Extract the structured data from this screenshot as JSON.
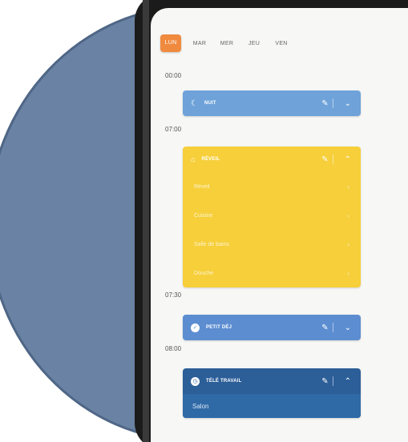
{
  "days": [
    "LUN",
    "MAR",
    "MER",
    "JEU",
    "VEN"
  ],
  "active_day_index": 0,
  "times": [
    "00:00",
    "07:00",
    "07:30",
    "08:00"
  ],
  "cards": {
    "nuit": {
      "title": "NUIT",
      "color": "#6ea2d9",
      "icon": "moon-icon"
    },
    "matin": {
      "title": "RÉVEIL",
      "color": "#f6cf3a",
      "icon": "bed-icon",
      "rows": [
        "Réveil",
        "Cuisine",
        "Salle de bains",
        "Douche"
      ]
    },
    "petit": {
      "title": "PETIT DÉJ",
      "color": "#5c8dd1",
      "icon": "check-icon"
    },
    "tele": {
      "title": "TÉLÉ TRAVAIL",
      "color": "#2c5e98",
      "icon": "clock-icon",
      "sub": "Salon"
    }
  },
  "icons": {
    "edit": "pencil-icon",
    "expand": "chevron-icon"
  }
}
